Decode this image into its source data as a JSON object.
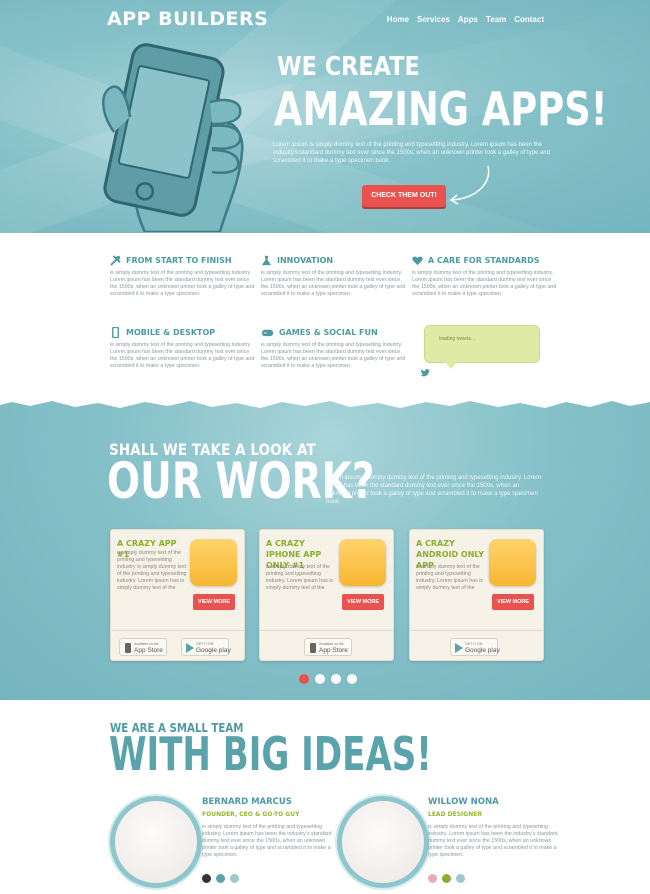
{
  "header": {
    "logo": "APP BUILDERS",
    "nav": [
      "Home",
      "Services",
      "Apps",
      "Team",
      "Contact"
    ]
  },
  "hero": {
    "subtitle": "WE CREATE",
    "title": "AMAZING APPS!",
    "text": "Lorem ipsum is simply dummy text of the printing and typesetting industry. Lorem ipsum has been the industry's standard dummy text ever since the 1500s, when an unknown printer took a galley of type and scrambled it to make a type specimen book.",
    "cta": "CHECK THEM OUT!"
  },
  "features": [
    {
      "title": "FROM START TO FINISH",
      "icon": "tools-icon",
      "text": "is simply dummy text of the printing and typesetting industry. Lorem ipsum has been the standard dummy text ever since the 1500s, when an unknown printer took a galley of type and scrambled it to make a type specimen."
    },
    {
      "title": "INNOVATION",
      "icon": "flask-icon",
      "text": "is simply dummy text of the printing and typesetting industry. Lorem ipsum has been the standard dummy text ever since the 1500s, when an unknown printer took a galley of type and scrambled it to make a type specimen."
    },
    {
      "title": "A CARE FOR STANDARDS",
      "icon": "heart-icon",
      "text": "is simply dummy text of the printing and typesetting industry. Lorem ipsum has been the standard dummy text ever since the 1500s, when an unknown printer took a galley of type and scrambled it to make a type specimen."
    },
    {
      "title": "MOBILE & DESKTOP",
      "icon": "mobile-icon",
      "text": "is simply dummy text of the printing and typesetting industry. Lorem ipsum has been the standard dummy text ever since the 1500s, when an unknown printer took a galley of type and scrambled it to make a type specimen."
    },
    {
      "title": "GAMES & SOCIAL FUN",
      "icon": "gamepad-icon",
      "text": "is simply dummy text of the printing and typesetting industry. Lorem ipsum has been the standard dummy text ever since the 1500s, when an unknown printer took a galley of type and scrambled it to make a type specimen."
    }
  ],
  "tweet": {
    "text": "loading tweets...",
    "icon": "twitter-icon"
  },
  "work": {
    "pretitle": "SHALL WE TAKE A LOOK AT",
    "title": "OUR WORK?",
    "text": "Lorem ipsum is simply dummy text of the printing and typesetting industry. Lorem ipsum has been the standard dummy text ever since the 1500s, when an unknown printer took a galley of type and scrambled it to make a type specimen book."
  },
  "apps": [
    {
      "title": "A CRAZY APP #1",
      "text": "is simply dummy text of the printing and typesetting industry is simply dummy text of the printing and typesetting industry. Lorem ipsum has is simply dummy text of the",
      "button": "VIEW MORE"
    },
    {
      "title": "A CRAZY IPHONE APP ONLY #1",
      "text": "is simply dummy text of the printing and typesetting industry. Lorem ipsum has is simply dummy text of the",
      "button": "VIEW MORE"
    },
    {
      "title": "A CRAZY ANDROID ONLY APP",
      "text": "is simply dummy text of the printing and typesetting industry. Lorem ipsum has is simply dummy text of the",
      "button": "VIEW MORE"
    }
  ],
  "stores": {
    "appstore_small": "Available on the",
    "appstore_large": "App Store",
    "googleplay_small": "GET IT ON",
    "googleplay_large": "Google play"
  },
  "carousel": {
    "total": 4,
    "active": 1
  },
  "team": {
    "pretitle": "WE ARE A SMALL TEAM",
    "title": "WITH BIG IDEAS!",
    "members": [
      {
        "name": "BERNARD MARCUS",
        "role": "FOUNDER, CEO & GO-TO GUY",
        "bio": "is simply dummy text of the printing and typesetting industry. Lorem ipsum has been the industry's standard dummy text ever since the 1500s, when an unknown printer took a galley of type and scrambled it to make a type specimen."
      },
      {
        "name": "WILLOW NONA",
        "role": "LEAD DESIGNER",
        "bio": "is simply dummy text of the printing and typesetting industry. Lorem ipsum has been the industry's standard dummy text ever since the 1500s, when an unknown printer took a galley of type and scrambled it to make a type specimen."
      }
    ]
  },
  "colors": {
    "teal": "#86c1c9",
    "accent_red": "#e9534f",
    "green": "#8aae2e",
    "card_bg": "#f6f2e7"
  }
}
